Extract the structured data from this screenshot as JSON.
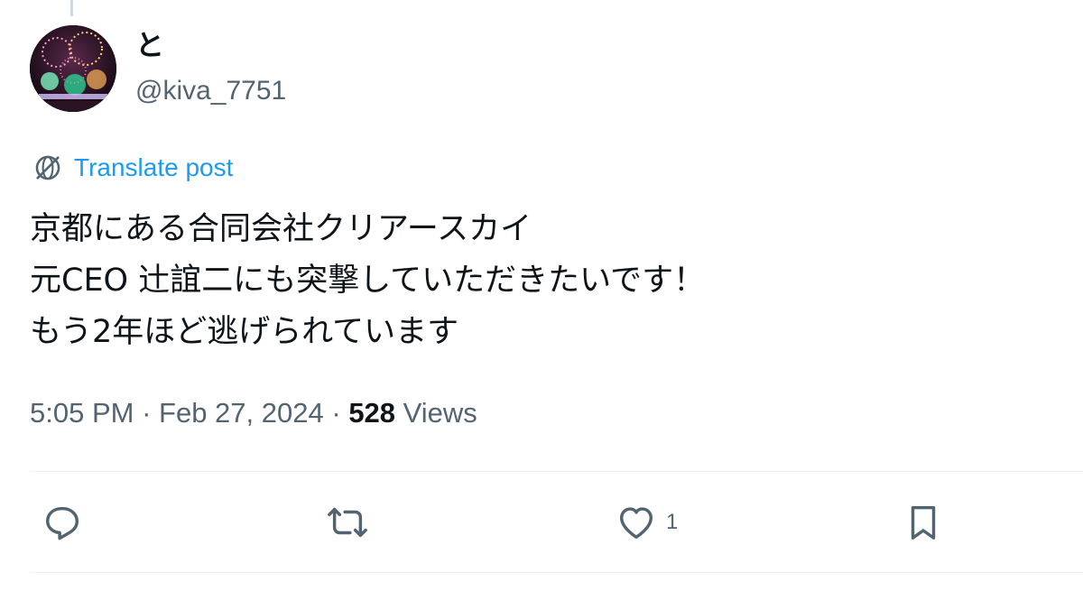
{
  "author": {
    "display_name": "と",
    "handle": "@kiva_7751",
    "avatar_icon": "fireworks-avatar"
  },
  "translate": {
    "icon": "globe-icon",
    "label": "Translate post"
  },
  "post": {
    "lines": [
      "京都にある合同会社クリアースカイ",
      "元CEO 辻誼二にも突撃していただきたいです！",
      "もう2年ほど逃げられています"
    ]
  },
  "meta": {
    "time": "5:05 PM",
    "separator": "·",
    "date": "Feb 27, 2024",
    "views_count": "528",
    "views_label": "Views"
  },
  "actions": {
    "reply": {
      "icon": "reply-icon",
      "count": ""
    },
    "repost": {
      "icon": "repost-icon",
      "count": ""
    },
    "like": {
      "icon": "heart-icon",
      "count": "1"
    },
    "bookmark": {
      "icon": "bookmark-icon",
      "count": ""
    }
  },
  "colors": {
    "link": "#1d9bf0",
    "secondary_text": "#536471",
    "primary_text": "#0f1419",
    "divider": "#eff3f4"
  }
}
